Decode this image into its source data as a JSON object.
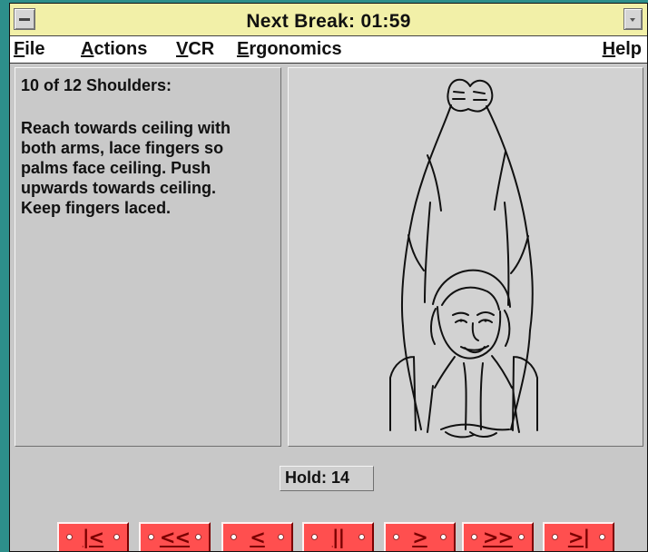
{
  "window": {
    "title": "Next Break: 01:59"
  },
  "menu": {
    "items": [
      "File",
      "Actions",
      "VCR",
      "Ergonomics",
      "Help"
    ]
  },
  "exercise": {
    "heading": "10 of 12 Shoulders:",
    "instruction_lines": [
      "Reach towards ceiling with",
      "both arms, lace fingers so",
      "palms face ceiling. Push",
      "upwards towards ceiling.",
      "Keep fingers laced."
    ]
  },
  "status": {
    "hold_text": "Hold: 14"
  },
  "controls": {
    "buttons": [
      {
        "label": "|<",
        "icon": "first-icon"
      },
      {
        "label": "<<",
        "icon": "rewind-icon"
      },
      {
        "label": "<",
        "icon": "previous-icon"
      },
      {
        "label": "||",
        "icon": "pause-icon"
      },
      {
        "label": ">",
        "icon": "next-icon"
      },
      {
        "label": ">>",
        "icon": "fast-forward-icon"
      },
      {
        "label": ">|",
        "icon": "last-icon"
      }
    ]
  },
  "colors": {
    "title_bar": "#f2f0a8",
    "menu_bar": "#ffffff",
    "panel_gray": "#c9c9c9",
    "button_red": "#ff4f4f",
    "button_text": "#7a0000",
    "desktop_teal": "#2d8f8b"
  },
  "icons": {
    "system_menu": "window-control-menu-icon",
    "minimize": "minimize-icon",
    "exercise_picture": "stretching-woman-illustration"
  }
}
